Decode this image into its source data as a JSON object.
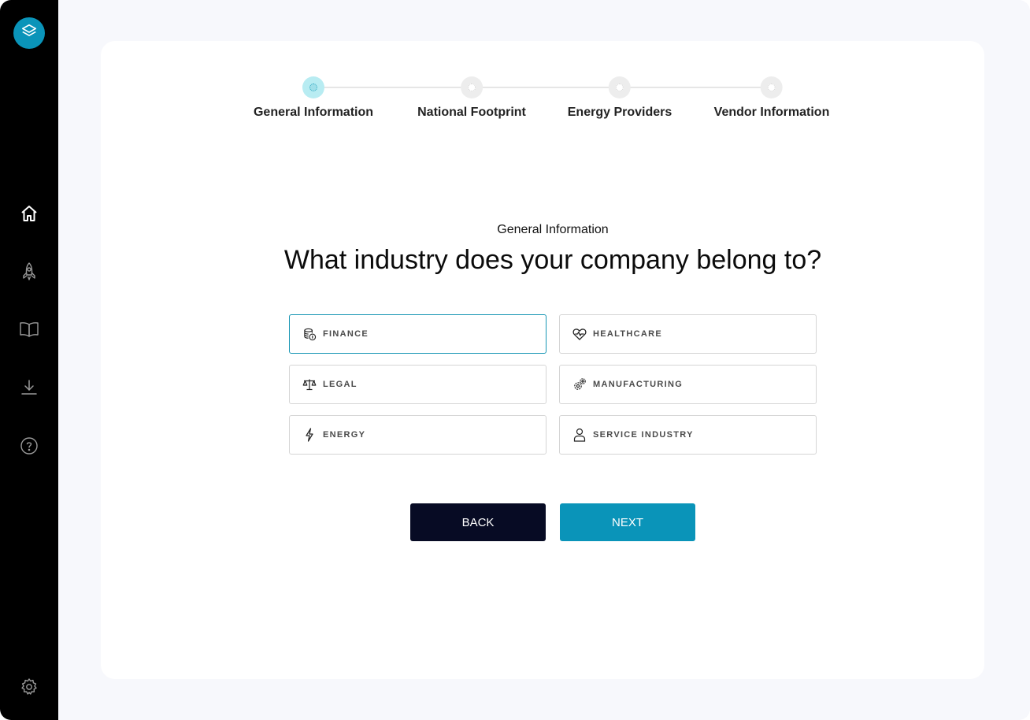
{
  "sidebar": {
    "logo_icon": "layers-icon",
    "items": [
      {
        "name": "home",
        "icon": "home-icon"
      },
      {
        "name": "launch",
        "icon": "rocket-icon"
      },
      {
        "name": "docs",
        "icon": "book-icon"
      },
      {
        "name": "download",
        "icon": "download-icon"
      },
      {
        "name": "help",
        "icon": "help-icon"
      }
    ],
    "settings_icon": "gear-icon"
  },
  "stepper": {
    "steps": [
      {
        "label": "General Information",
        "active": true
      },
      {
        "label": "National Footprint",
        "active": false
      },
      {
        "label": "Energy Providers",
        "active": false
      },
      {
        "label": "Vendor Information",
        "active": false
      }
    ]
  },
  "main": {
    "subtitle": "General Information",
    "question": "What industry does your company belong to?",
    "options": [
      {
        "label": "FINANCE",
        "icon": "coins-icon",
        "selected": true
      },
      {
        "label": "HEALTHCARE",
        "icon": "heartbeat-icon",
        "selected": false
      },
      {
        "label": "LEGAL",
        "icon": "scales-icon",
        "selected": false
      },
      {
        "label": "MANUFACTURING",
        "icon": "gears-icon",
        "selected": false
      },
      {
        "label": "ENERGY",
        "icon": "bolt-icon",
        "selected": false
      },
      {
        "label": "SERVICE INDUSTRY",
        "icon": "person-icon",
        "selected": false
      }
    ],
    "back_label": "BACK",
    "next_label": "NEXT"
  },
  "colors": {
    "accent": "#0a94b9",
    "sidebar_bg": "#000000",
    "back_button": "#070b24",
    "selected_border": "#1796b4"
  }
}
